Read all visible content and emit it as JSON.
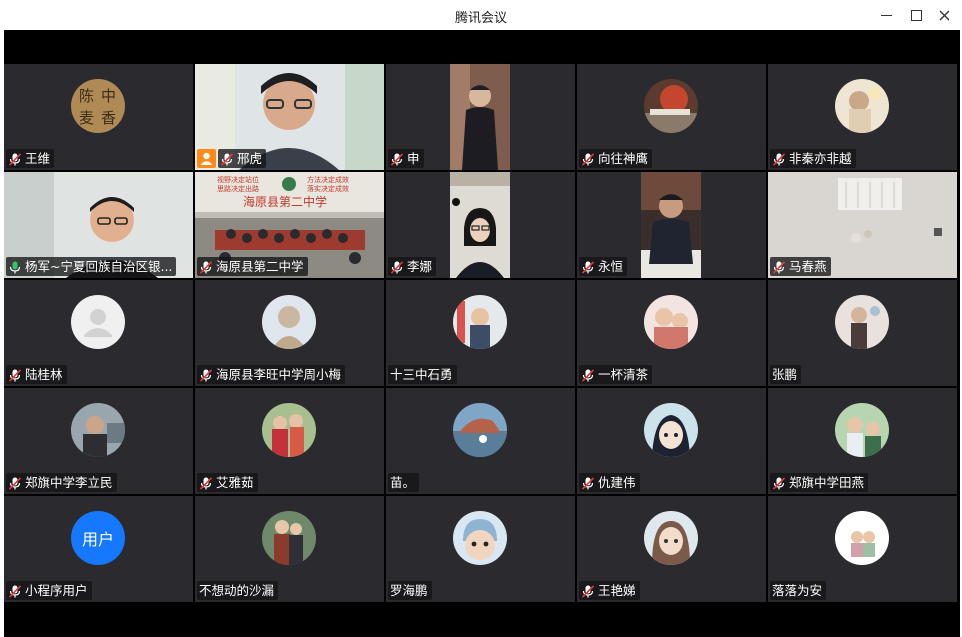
{
  "window": {
    "title": "腾讯会议",
    "minimize_icon": "minimize-icon",
    "maximize_icon": "maximize-icon",
    "close_icon": "close-icon"
  },
  "avatar_text": "用户",
  "participants": [
    {
      "name": "王维",
      "mic": "muted",
      "view": "avatar"
    },
    {
      "name": "邢虎",
      "mic": "muted",
      "view": "video",
      "host_badge": true
    },
    {
      "name": "申",
      "mic": "muted",
      "view": "video"
    },
    {
      "name": "向往神鹰",
      "mic": "muted",
      "view": "avatar"
    },
    {
      "name": "非秦亦非越",
      "mic": "muted",
      "view": "avatar"
    },
    {
      "name": "杨军~宁夏回族自治区银...",
      "mic": "on",
      "view": "video",
      "speaking": true
    },
    {
      "name": "海原县第二中学",
      "mic": "muted",
      "view": "video"
    },
    {
      "name": "李娜",
      "mic": "muted",
      "view": "video"
    },
    {
      "name": "永恒",
      "mic": "muted",
      "view": "video"
    },
    {
      "name": "马春燕",
      "mic": "muted",
      "view": "video"
    },
    {
      "name": "陆桂林",
      "mic": "muted",
      "view": "avatar"
    },
    {
      "name": "海原县李旺中学周小梅",
      "mic": "muted",
      "view": "avatar"
    },
    {
      "name": "十三中石勇",
      "mic": "none",
      "view": "avatar"
    },
    {
      "name": "一杯清茶",
      "mic": "muted",
      "view": "avatar"
    },
    {
      "name": "张鹏",
      "mic": "none",
      "view": "avatar"
    },
    {
      "name": "郑旗中学李立民",
      "mic": "muted",
      "view": "avatar"
    },
    {
      "name": "艾雅茹",
      "mic": "muted",
      "view": "avatar"
    },
    {
      "name": "苗。",
      "mic": "none",
      "view": "avatar"
    },
    {
      "name": "仇建伟",
      "mic": "muted",
      "view": "avatar"
    },
    {
      "name": "郑旗中学田燕",
      "mic": "muted",
      "view": "avatar"
    },
    {
      "name": "小程序用户",
      "mic": "muted",
      "view": "avatar"
    },
    {
      "name": "不想动的沙漏",
      "mic": "none",
      "view": "avatar"
    },
    {
      "name": "罗海鹏",
      "mic": "none",
      "view": "avatar"
    },
    {
      "name": "王艳娣",
      "mic": "muted",
      "view": "avatar"
    },
    {
      "name": "落落为安",
      "mic": "none",
      "view": "avatar"
    }
  ],
  "colors": {
    "tile_bg": "#2b2b2f",
    "stage_bg": "#000000",
    "muted_icon": "#ffffff",
    "mute_slash": "#e33b3b",
    "active_mic": "#36c46a",
    "speaking_border": "#36c46a",
    "host_badge": "#ff8a1a",
    "default_avatar_blue": "#1677ff"
  },
  "school_banner": {
    "line1a": "视野决定站位",
    "line1b": "方法决定成效",
    "line2a": "思路决定出路",
    "line2b": "落实决定成效",
    "school_name": "海原县第二中学"
  },
  "calligraphy": {
    "chars": [
      "陈",
      "中",
      "麦",
      "香"
    ]
  }
}
